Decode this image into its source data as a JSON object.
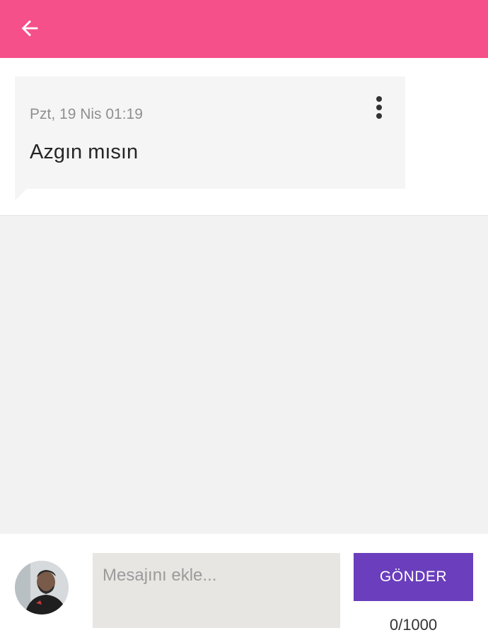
{
  "header": {
    "title": "",
    "background_color": "#f5508a",
    "back_icon": "arrow-left-icon"
  },
  "message": {
    "timestamp": "Pzt, 19 Nis 01:19",
    "text": "Azgın mısın",
    "more_icon": "more-vertical-icon"
  },
  "composer": {
    "placeholder": "Mesajını ekle...",
    "value": "",
    "send_label": "GÖNDER",
    "send_color": "#6a3ebc",
    "counter": "0/1000"
  }
}
